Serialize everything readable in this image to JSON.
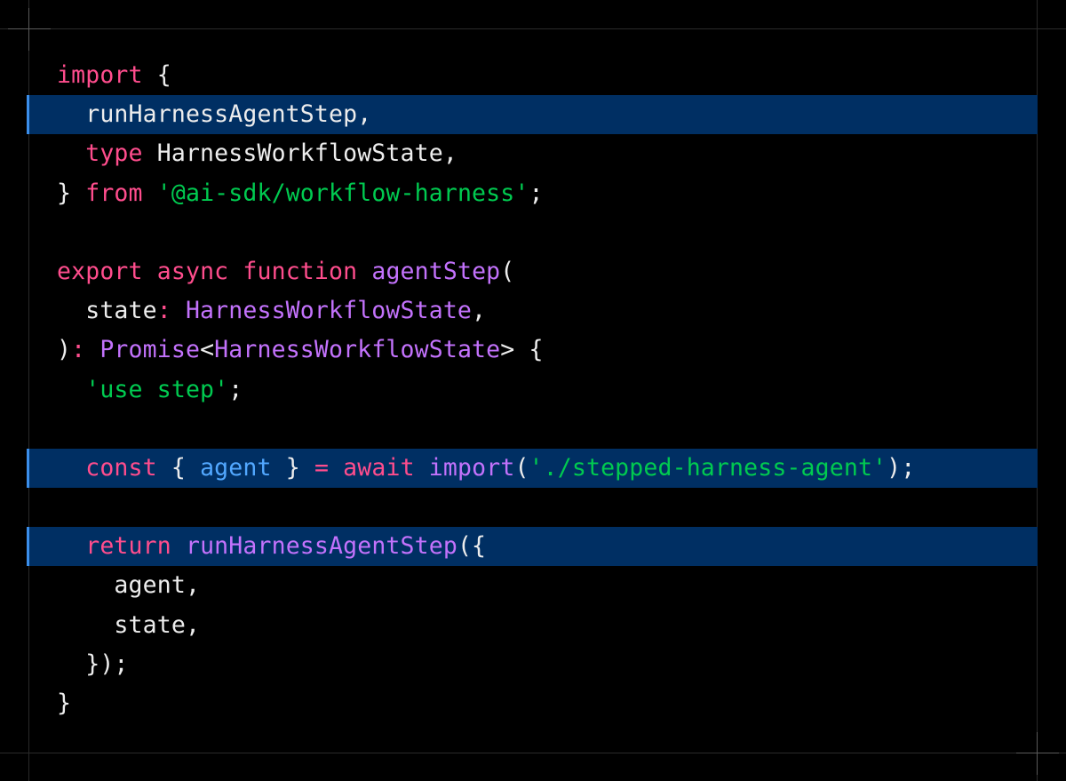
{
  "colors": {
    "background": "#000000",
    "highlight": "#002f63",
    "highlight_bar": "#3b8eea",
    "keyword": "#ff4d8d",
    "function": "#c372fc",
    "string": "#00ca50",
    "variable": "#52a8ff",
    "plain": "#ededed"
  },
  "code": {
    "language": "typescript",
    "lines": [
      {
        "highlighted": false,
        "tokens": [
          {
            "t": "import",
            "c": "keyword"
          },
          {
            "t": " {",
            "c": "plain"
          }
        ]
      },
      {
        "highlighted": true,
        "tokens": [
          {
            "t": "  runHarnessAgentStep,",
            "c": "plain"
          }
        ]
      },
      {
        "highlighted": false,
        "tokens": [
          {
            "t": "  ",
            "c": "plain"
          },
          {
            "t": "type",
            "c": "keyword"
          },
          {
            "t": " HarnessWorkflowState,",
            "c": "plain"
          }
        ]
      },
      {
        "highlighted": false,
        "tokens": [
          {
            "t": "} ",
            "c": "plain"
          },
          {
            "t": "from",
            "c": "keyword"
          },
          {
            "t": " ",
            "c": "plain"
          },
          {
            "t": "'@ai-sdk/workflow-harness'",
            "c": "string"
          },
          {
            "t": ";",
            "c": "plain"
          }
        ]
      },
      {
        "highlighted": false,
        "tokens": []
      },
      {
        "highlighted": false,
        "tokens": [
          {
            "t": "export",
            "c": "keyword"
          },
          {
            "t": " ",
            "c": "plain"
          },
          {
            "t": "async",
            "c": "keyword"
          },
          {
            "t": " ",
            "c": "plain"
          },
          {
            "t": "function",
            "c": "keyword"
          },
          {
            "t": " ",
            "c": "plain"
          },
          {
            "t": "agentStep",
            "c": "function"
          },
          {
            "t": "(",
            "c": "plain"
          }
        ]
      },
      {
        "highlighted": false,
        "tokens": [
          {
            "t": "  state",
            "c": "plain"
          },
          {
            "t": ":",
            "c": "keyword"
          },
          {
            "t": " ",
            "c": "plain"
          },
          {
            "t": "HarnessWorkflowState",
            "c": "function"
          },
          {
            "t": ",",
            "c": "plain"
          }
        ]
      },
      {
        "highlighted": false,
        "tokens": [
          {
            "t": ")",
            "c": "plain"
          },
          {
            "t": ":",
            "c": "keyword"
          },
          {
            "t": " ",
            "c": "plain"
          },
          {
            "t": "Promise",
            "c": "function"
          },
          {
            "t": "<",
            "c": "plain"
          },
          {
            "t": "HarnessWorkflowState",
            "c": "function"
          },
          {
            "t": "> {",
            "c": "plain"
          }
        ]
      },
      {
        "highlighted": false,
        "tokens": [
          {
            "t": "  ",
            "c": "plain"
          },
          {
            "t": "'use step'",
            "c": "string"
          },
          {
            "t": ";",
            "c": "plain"
          }
        ]
      },
      {
        "highlighted": false,
        "tokens": []
      },
      {
        "highlighted": true,
        "tokens": [
          {
            "t": "  ",
            "c": "plain"
          },
          {
            "t": "const",
            "c": "keyword"
          },
          {
            "t": " { ",
            "c": "plain"
          },
          {
            "t": "agent",
            "c": "variable"
          },
          {
            "t": " } ",
            "c": "plain"
          },
          {
            "t": "=",
            "c": "keyword"
          },
          {
            "t": " ",
            "c": "plain"
          },
          {
            "t": "await",
            "c": "keyword"
          },
          {
            "t": " ",
            "c": "plain"
          },
          {
            "t": "import",
            "c": "function"
          },
          {
            "t": "(",
            "c": "plain"
          },
          {
            "t": "'./stepped-harness-agent'",
            "c": "string"
          },
          {
            "t": ");",
            "c": "plain"
          }
        ]
      },
      {
        "highlighted": false,
        "tokens": []
      },
      {
        "highlighted": true,
        "tokens": [
          {
            "t": "  ",
            "c": "plain"
          },
          {
            "t": "return",
            "c": "keyword"
          },
          {
            "t": " ",
            "c": "plain"
          },
          {
            "t": "runHarnessAgentStep",
            "c": "function"
          },
          {
            "t": "({",
            "c": "plain"
          }
        ]
      },
      {
        "highlighted": false,
        "tokens": [
          {
            "t": "    agent,",
            "c": "plain"
          }
        ]
      },
      {
        "highlighted": false,
        "tokens": [
          {
            "t": "    state,",
            "c": "plain"
          }
        ]
      },
      {
        "highlighted": false,
        "tokens": [
          {
            "t": "  });",
            "c": "plain"
          }
        ]
      },
      {
        "highlighted": false,
        "tokens": [
          {
            "t": "}",
            "c": "plain"
          }
        ]
      }
    ]
  }
}
